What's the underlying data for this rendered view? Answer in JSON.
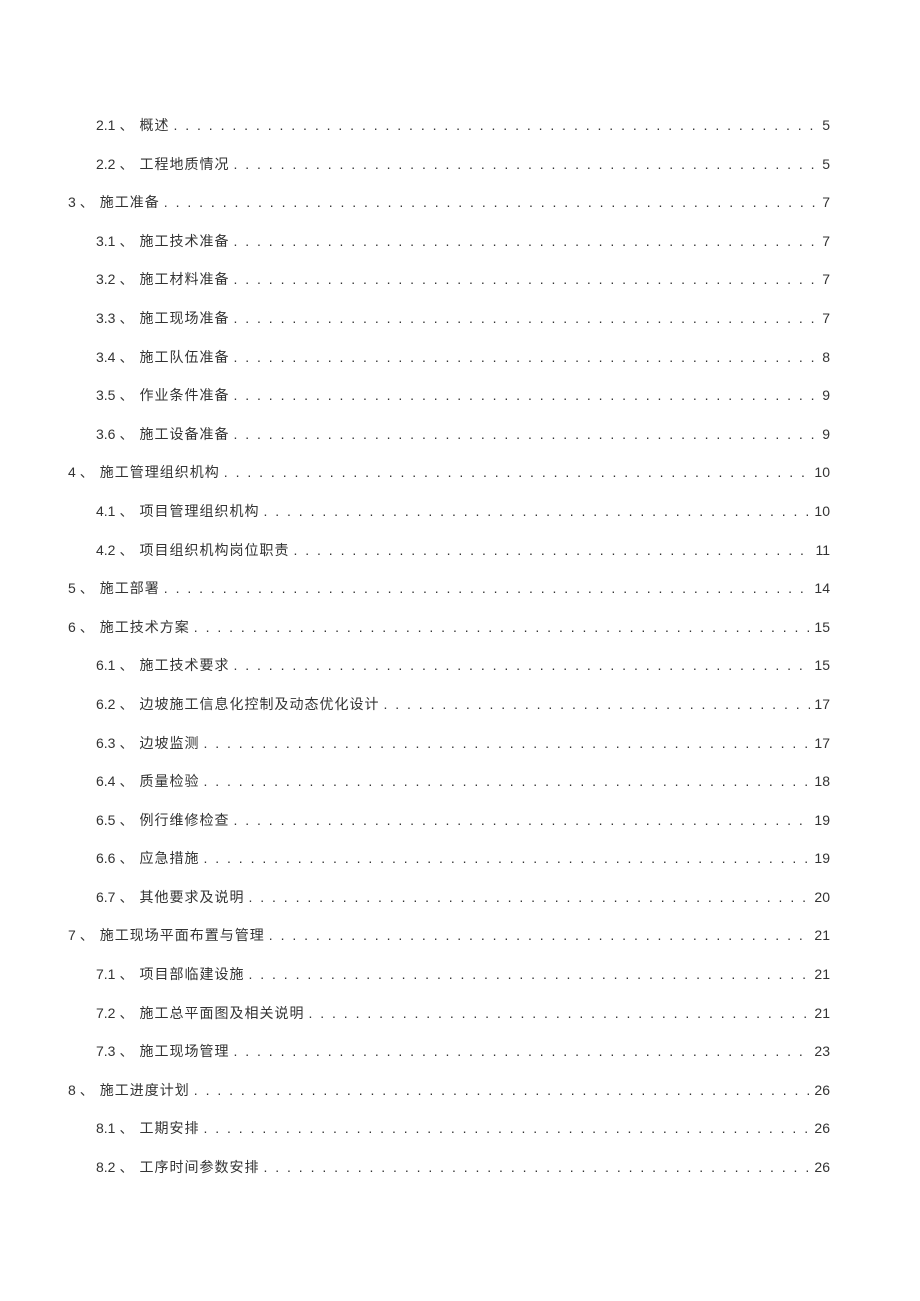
{
  "toc": [
    {
      "level": 2,
      "num": "2.1",
      "sep": "、",
      "title": "概述",
      "page": "5"
    },
    {
      "level": 2,
      "num": "2.2",
      "sep": "、",
      "title": "工程地质情况",
      "page": "5"
    },
    {
      "level": 1,
      "num": "3",
      "sep": "、",
      "title": "施工准备",
      "page": "7"
    },
    {
      "level": 2,
      "num": "3.1",
      "sep": "、",
      "title": "施工技术准备",
      "page": "7"
    },
    {
      "level": 2,
      "num": "3.2",
      "sep": "、",
      "title": "施工材料准备",
      "page": "7"
    },
    {
      "level": 2,
      "num": "3.3",
      "sep": "、",
      "title": "施工现场准备",
      "page": "7"
    },
    {
      "level": 2,
      "num": "3.4",
      "sep": "、",
      "title": "施工队伍准备",
      "page": "8"
    },
    {
      "level": 2,
      "num": "3.5",
      "sep": "、",
      "title": "作业条件准备",
      "page": "9"
    },
    {
      "level": 2,
      "num": "3.6",
      "sep": "、",
      "title": "施工设备准备",
      "page": "9"
    },
    {
      "level": 1,
      "num": "4",
      "sep": "、",
      "title": "施工管理组织机构",
      "page": "10"
    },
    {
      "level": 2,
      "num": "4.1",
      "sep": "、",
      "title": "项目管理组织机构",
      "page": "10"
    },
    {
      "level": 2,
      "num": "4.2",
      "sep": "、",
      "title": "项目组织机构岗位职责",
      "page": "11"
    },
    {
      "level": 1,
      "num": "5",
      "sep": "、",
      "title": "施工部署",
      "page": "14"
    },
    {
      "level": 1,
      "num": "6",
      "sep": "、",
      "title": "施工技术方案",
      "page": "15"
    },
    {
      "level": 2,
      "num": "6.1",
      "sep": "、",
      "title": "施工技术要求",
      "page": "15"
    },
    {
      "level": 2,
      "num": "6.2",
      "sep": "、",
      "title": "边坡施工信息化控制及动态优化设计",
      "page": "17"
    },
    {
      "level": 2,
      "num": "6.3",
      "sep": "、",
      "title": "边坡监测",
      "page": "17"
    },
    {
      "level": 2,
      "num": "6.4",
      "sep": "、",
      "title": "质量检验",
      "page": "18"
    },
    {
      "level": 2,
      "num": "6.5",
      "sep": "、",
      "title": "例行维修检查",
      "page": "19"
    },
    {
      "level": 2,
      "num": "6.6",
      "sep": "、",
      "title": "应急措施",
      "page": "19"
    },
    {
      "level": 2,
      "num": "6.7",
      "sep": "、",
      "title": "其他要求及说明",
      "page": "20"
    },
    {
      "level": 1,
      "num": "7",
      "sep": "、",
      "title": "施工现场平面布置与管理",
      "page": "21"
    },
    {
      "level": 2,
      "num": "7.1",
      "sep": "、",
      "title": "项目部临建设施",
      "page": "21"
    },
    {
      "level": 2,
      "num": "7.2",
      "sep": "、",
      "title": "施工总平面图及相关说明",
      "page": "21"
    },
    {
      "level": 2,
      "num": "7.3",
      "sep": "、",
      "title": "施工现场管理",
      "page": "23"
    },
    {
      "level": 1,
      "num": "8",
      "sep": "、",
      "title": "施工进度计划",
      "page": "26"
    },
    {
      "level": 2,
      "num": "8.1",
      "sep": "、",
      "title": "工期安排",
      "page": "26"
    },
    {
      "level": 2,
      "num": "8.2",
      "sep": "、",
      "title": "工序时间参数安排",
      "page": "26"
    }
  ]
}
